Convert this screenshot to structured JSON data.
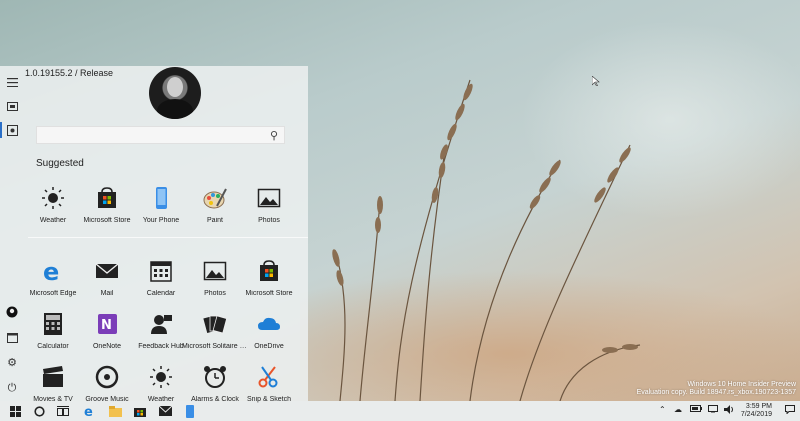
{
  "start_menu": {
    "version": "1.0.19155.2 / Release",
    "search_placeholder": "",
    "suggested_label": "Suggested",
    "suggested": [
      {
        "label": "Weather",
        "icon": "sun-icon"
      },
      {
        "label": "Microsoft Store",
        "icon": "store-bag-icon"
      },
      {
        "label": "Your Phone",
        "icon": "phone-icon"
      },
      {
        "label": "Paint",
        "icon": "palette-icon"
      },
      {
        "label": "Photos",
        "icon": "photo-icon"
      }
    ],
    "apps_row1": [
      {
        "label": "Microsoft Edge",
        "icon": "edge-icon"
      },
      {
        "label": "Mail",
        "icon": "mail-icon"
      },
      {
        "label": "Calendar",
        "icon": "calendar-icon"
      },
      {
        "label": "Photos",
        "icon": "photo-icon"
      },
      {
        "label": "Microsoft Store",
        "icon": "store-bag-icon"
      }
    ],
    "apps_row2": [
      {
        "label": "Calculator",
        "icon": "calculator-icon"
      },
      {
        "label": "OneNote",
        "icon": "onenote-icon"
      },
      {
        "label": "Feedback Hub",
        "icon": "feedback-icon"
      },
      {
        "label": "Microsoft Solitaire Collection",
        "icon": "cards-icon"
      },
      {
        "label": "OneDrive",
        "icon": "cloud-icon"
      }
    ],
    "apps_row3": [
      {
        "label": "Movies & TV",
        "icon": "clapper-icon"
      },
      {
        "label": "Groove Music",
        "icon": "groove-icon"
      },
      {
        "label": "Weather",
        "icon": "sun-icon"
      },
      {
        "label": "Alarms & Clock",
        "icon": "alarm-icon"
      },
      {
        "label": "Snip & Sketch",
        "icon": "scissors-icon"
      }
    ]
  },
  "watermark": {
    "line1": "Windows 10 Home Insider Preview",
    "line2": "Evaluation copy. Build 18947.rs_xbox.190723-1357"
  },
  "clock": {
    "time": "3:59 PM",
    "date": "7/24/2019"
  },
  "colors": {
    "accent": "#2a6fc7",
    "store_red": "#f25022",
    "store_green": "#7fba00",
    "store_blue": "#00a4ef",
    "store_yellow": "#ffb900",
    "onenote": "#7b3db8",
    "onedrive": "#1f7fd6"
  }
}
